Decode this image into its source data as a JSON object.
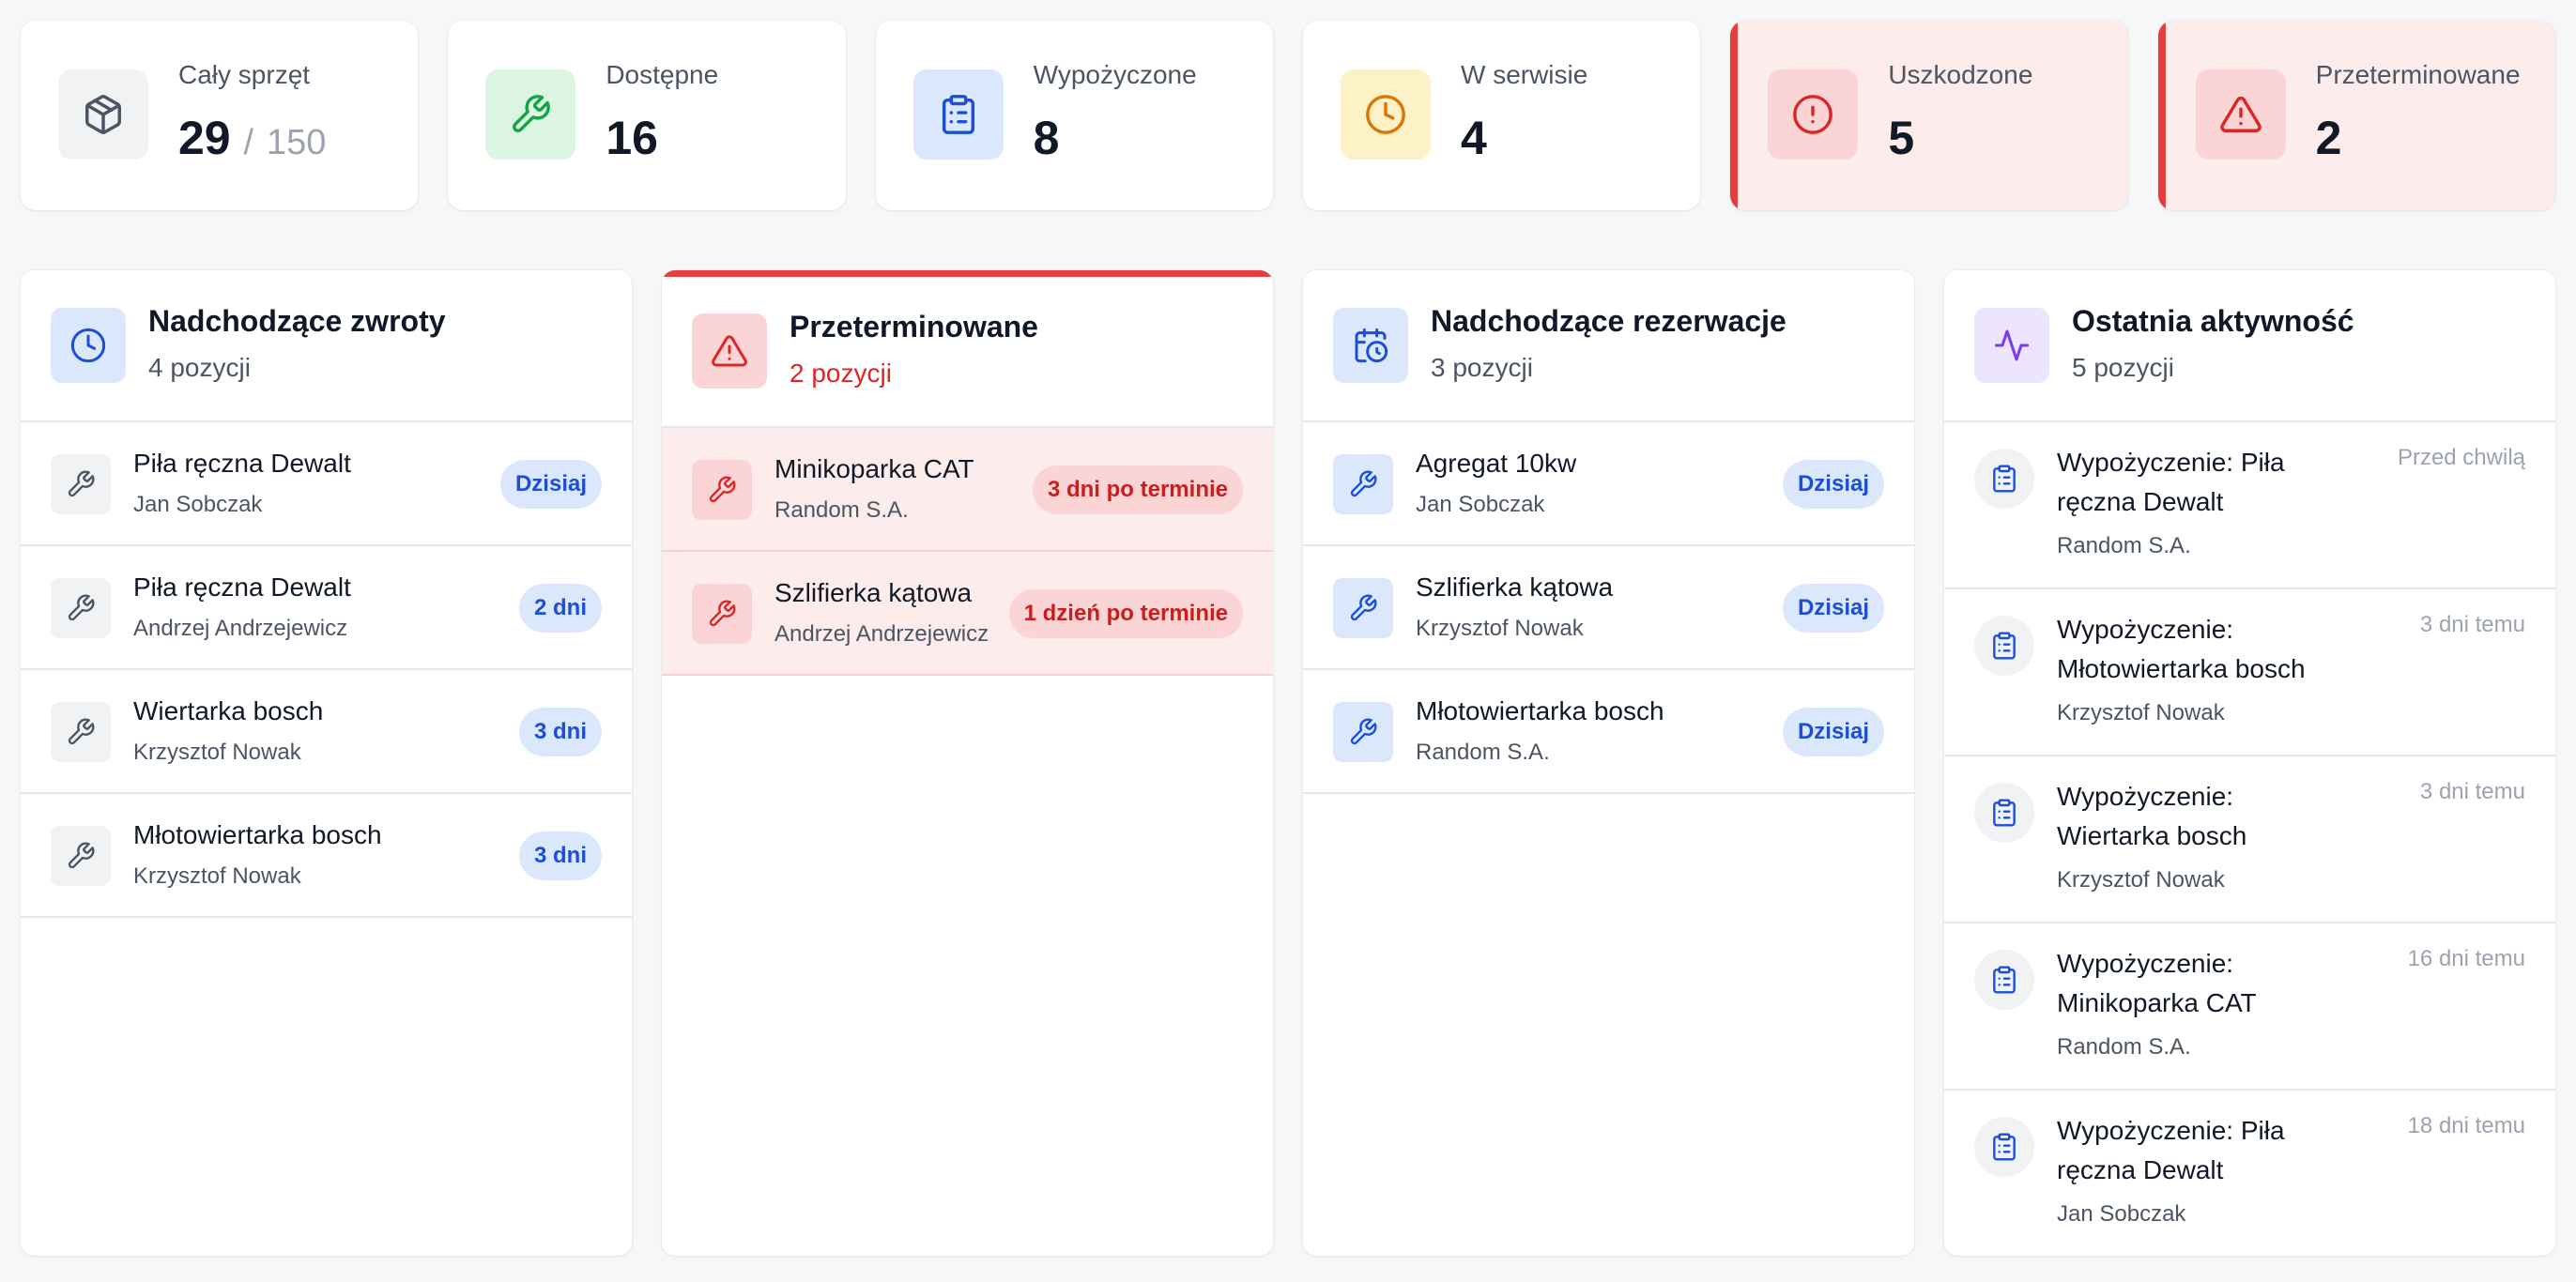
{
  "stats": [
    {
      "label": "Cały sprzęt",
      "value": "29",
      "separator": "/",
      "total": "150",
      "icon": "box-icon",
      "icon_bg": "#f1f2f4",
      "icon_color": "#4b5563"
    },
    {
      "label": "Dostępne",
      "value": "16",
      "icon": "wrench-icon",
      "icon_bg": "#dcf5e3",
      "icon_color": "#16a34a"
    },
    {
      "label": "Wypożyczone",
      "value": "8",
      "icon": "clipboard-icon",
      "icon_bg": "#dbe8fb",
      "icon_color": "#1d4ed8"
    },
    {
      "label": "W serwisie",
      "value": "4",
      "icon": "clock-icon",
      "icon_bg": "#fdf1c7",
      "icon_color": "#d97706"
    },
    {
      "label": "Uszkodzone",
      "value": "5",
      "icon": "alert-circle-icon",
      "icon_bg": "#fbd5d5",
      "icon_color": "#dc2626"
    },
    {
      "label": "Przeterminowane",
      "value": "2",
      "icon": "alert-triangle-icon",
      "icon_bg": "#fbd5d5",
      "icon_color": "#dc2626"
    }
  ],
  "returns": {
    "title": "Nadchodzące zwroty",
    "count": "4 pozycji",
    "items": [
      {
        "name": "Piła ręczna Dewalt",
        "person": "Jan Sobczak",
        "badge": "Dzisiaj"
      },
      {
        "name": "Piła ręczna Dewalt",
        "person": "Andrzej Andrzejewicz",
        "badge": "2 dni"
      },
      {
        "name": "Wiertarka bosch",
        "person": "Krzysztof Nowak",
        "badge": "3 dni"
      },
      {
        "name": "Młotowiertarka bosch",
        "person": "Krzysztof Nowak",
        "badge": "3 dni"
      }
    ]
  },
  "overdue": {
    "title": "Przeterminowane",
    "count": "2 pozycji",
    "items": [
      {
        "name": "Minikoparka CAT",
        "person": "Random S.A.",
        "badge": "3 dni po terminie"
      },
      {
        "name": "Szlifierka kątowa",
        "person": "Andrzej Andrzejewicz",
        "badge": "1 dzień po terminie"
      }
    ]
  },
  "reservations": {
    "title": "Nadchodzące rezerwacje",
    "count": "3 pozycji",
    "items": [
      {
        "name": "Agregat 10kw",
        "person": "Jan Sobczak",
        "badge": "Dzisiaj"
      },
      {
        "name": "Szlifierka kątowa",
        "person": "Krzysztof Nowak",
        "badge": "Dzisiaj"
      },
      {
        "name": "Młotowiertarka bosch",
        "person": "Random S.A.",
        "badge": "Dzisiaj"
      }
    ]
  },
  "activity": {
    "title": "Ostatnia aktywność",
    "count": "5 pozycji",
    "items": [
      {
        "title": "Wypożyczenie: Piła ręczna Dewalt",
        "person": "Random S.A.",
        "time": "Przed chwilą"
      },
      {
        "title": "Wypożyczenie: Młotowiertarka bosch",
        "person": "Krzysztof Nowak",
        "time": "3 dni temu"
      },
      {
        "title": "Wypożyczenie: Wiertarka bosch",
        "person": "Krzysztof Nowak",
        "time": "3 dni temu"
      },
      {
        "title": "Wypożyczenie: Minikoparka CAT",
        "person": "Random S.A.",
        "time": "16 dni temu"
      },
      {
        "title": "Wypożyczenie: Piła ręczna Dewalt",
        "person": "Jan Sobczak",
        "time": "18 dni temu"
      }
    ]
  },
  "colors": {
    "accent_blue": "#1d4ed8",
    "danger": "#e53e3e",
    "danger_bg": "#fdecec",
    "success": "#16a34a",
    "warning": "#d97706",
    "purple": "#7c3aed"
  }
}
